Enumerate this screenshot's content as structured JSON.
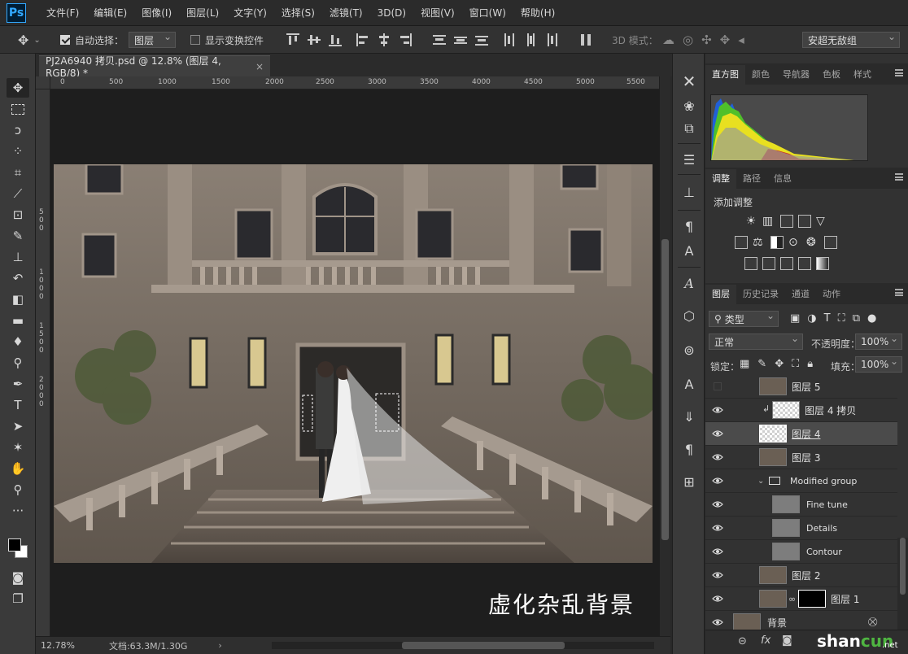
{
  "app": {
    "logo": "Ps"
  },
  "menu": [
    "文件(F)",
    "编辑(E)",
    "图像(I)",
    "图层(L)",
    "文字(Y)",
    "选择(S)",
    "滤镜(T)",
    "3D(D)",
    "视图(V)",
    "窗口(W)",
    "帮助(H)"
  ],
  "options": {
    "auto_select_label": "自动选择：",
    "auto_select_checked": true,
    "auto_select_target": "图层",
    "show_transform_label": "显示变换控件",
    "show_transform_checked": false,
    "mode3d_label": "3D 模式：",
    "font_select": "安超无敌组"
  },
  "document": {
    "tab_title": "PJ2A6940 拷贝.psd @ 12.8% (图层 4, RGB/8) *",
    "close_glyph": "×",
    "ruler_marks": [
      "0",
      "500",
      "1000",
      "1500",
      "2000",
      "2500",
      "3000",
      "3500",
      "4000",
      "4500",
      "5000",
      "5500"
    ],
    "ruler_left_marks": [
      "5",
      "0",
      "0",
      "1",
      "0",
      "0",
      "0",
      "1",
      "5",
      "0",
      "0",
      "2",
      "0",
      "0",
      "0"
    ],
    "caption": "虚化杂乱背景"
  },
  "status": {
    "zoom": "12.78%",
    "doc_info": "文档:63.3M/1.30G",
    "arrow": "›"
  },
  "panels": {
    "top_tabs": [
      "直方图",
      "颜色",
      "导航器",
      "色板",
      "样式"
    ],
    "adjust_tabs": [
      "调整",
      "路径",
      "信息"
    ],
    "adjust_title": "添加调整",
    "layers_tabs": [
      "图层",
      "历史记录",
      "通道",
      "动作"
    ]
  },
  "layers_panel": {
    "filter_kind": "类型",
    "blend_mode": "正常",
    "opacity_label": "不透明度：",
    "opacity_value": "100%",
    "lock_label": "锁定：",
    "fill_label": "填充：",
    "fill_value": "100%",
    "layers": [
      {
        "name": "图层 5",
        "visible": false,
        "thumb": "photo"
      },
      {
        "name": "图层 4 拷贝",
        "visible": true,
        "thumb": "checker",
        "clipped": true
      },
      {
        "name": "图层 4",
        "visible": true,
        "thumb": "checker",
        "selected": true
      },
      {
        "name": "图层 3",
        "visible": true,
        "thumb": "photo"
      },
      {
        "name": "Modified group",
        "visible": true,
        "thumb": "folder"
      },
      {
        "name": "Fine tune",
        "visible": true,
        "thumb": "gray"
      },
      {
        "name": "Details",
        "visible": true,
        "thumb": "gray"
      },
      {
        "name": "Contour",
        "visible": true,
        "thumb": "gray"
      },
      {
        "name": "图层 2",
        "visible": true,
        "thumb": "photo"
      },
      {
        "name": "图层 1",
        "visible": true,
        "thumb": "photo",
        "mask": true
      },
      {
        "name": "背景",
        "visible": true,
        "thumb": "photo",
        "locked": true
      }
    ]
  },
  "watermark": {
    "part1": "shan",
    "part2": "cun",
    "suffix": ".net"
  },
  "colors": {
    "accent": "#31a8ff",
    "panel": "#323232",
    "dark": "#282828"
  }
}
